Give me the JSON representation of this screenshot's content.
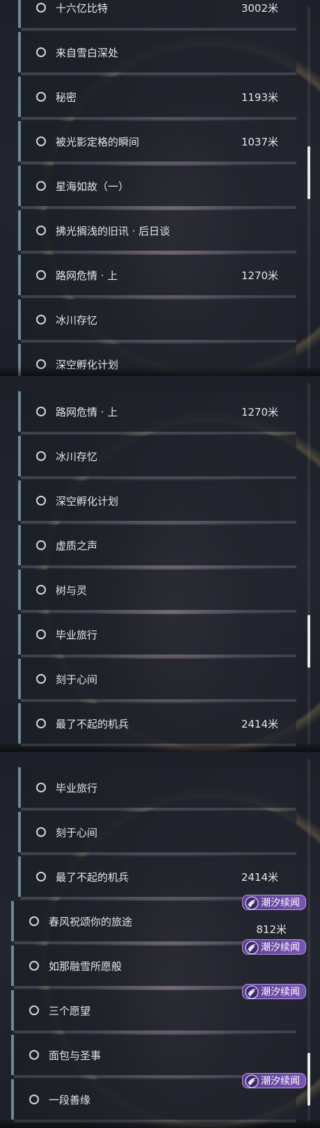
{
  "panels": [
    {
      "items": [
        {
          "name": "十六亿比特",
          "dist": "3002米"
        },
        {
          "name": "来自雪白深处",
          "dist": ""
        },
        {
          "name": "秘密",
          "dist": "1193米"
        },
        {
          "name": "被光影定格的瞬间",
          "dist": "1037米"
        },
        {
          "name": "星海如故（一）",
          "dist": ""
        },
        {
          "name": "拂光搁浅的旧讯 · 后日谈",
          "dist": ""
        },
        {
          "name": "路网危情 · 上",
          "dist": "1270米"
        },
        {
          "name": "冰川存忆",
          "dist": ""
        },
        {
          "name": "深空孵化计划",
          "dist": ""
        }
      ]
    },
    {
      "items": [
        {
          "name": "路网危情 · 上",
          "dist": "1270米"
        },
        {
          "name": "冰川存忆",
          "dist": ""
        },
        {
          "name": "深空孵化计划",
          "dist": ""
        },
        {
          "name": "虚质之声",
          "dist": ""
        },
        {
          "name": "树与灵",
          "dist": ""
        },
        {
          "name": "毕业旅行",
          "dist": ""
        },
        {
          "name": "刻于心间",
          "dist": ""
        },
        {
          "name": "最了不起的机兵",
          "dist": "2414米"
        }
      ]
    },
    {
      "items": [
        {
          "name": "毕业旅行",
          "dist": ""
        },
        {
          "name": "刻于心间",
          "dist": ""
        },
        {
          "name": "最了不起的机兵",
          "dist": "2414米"
        }
      ],
      "tagged_items": [
        {
          "name": "春风祝颂你的旅途",
          "dist": "812米",
          "tag": "潮汐续闻"
        },
        {
          "name": "如那融雪所愿般",
          "dist": "",
          "tag": "潮汐续闻"
        },
        {
          "name": "三个愿望",
          "dist": "",
          "tag": "潮汐续闻"
        },
        {
          "name": "面包与圣事",
          "dist": "",
          "tag": ""
        },
        {
          "name": "一段善缘",
          "dist": "",
          "tag": "潮汐续闻"
        }
      ]
    }
  ],
  "colors": {
    "accent_bar": "#6f8796",
    "tag_bg": "#6a4aa8",
    "text": "#e6e6ea"
  },
  "scroll_positions": [
    0.45,
    0.75,
    0.95
  ]
}
